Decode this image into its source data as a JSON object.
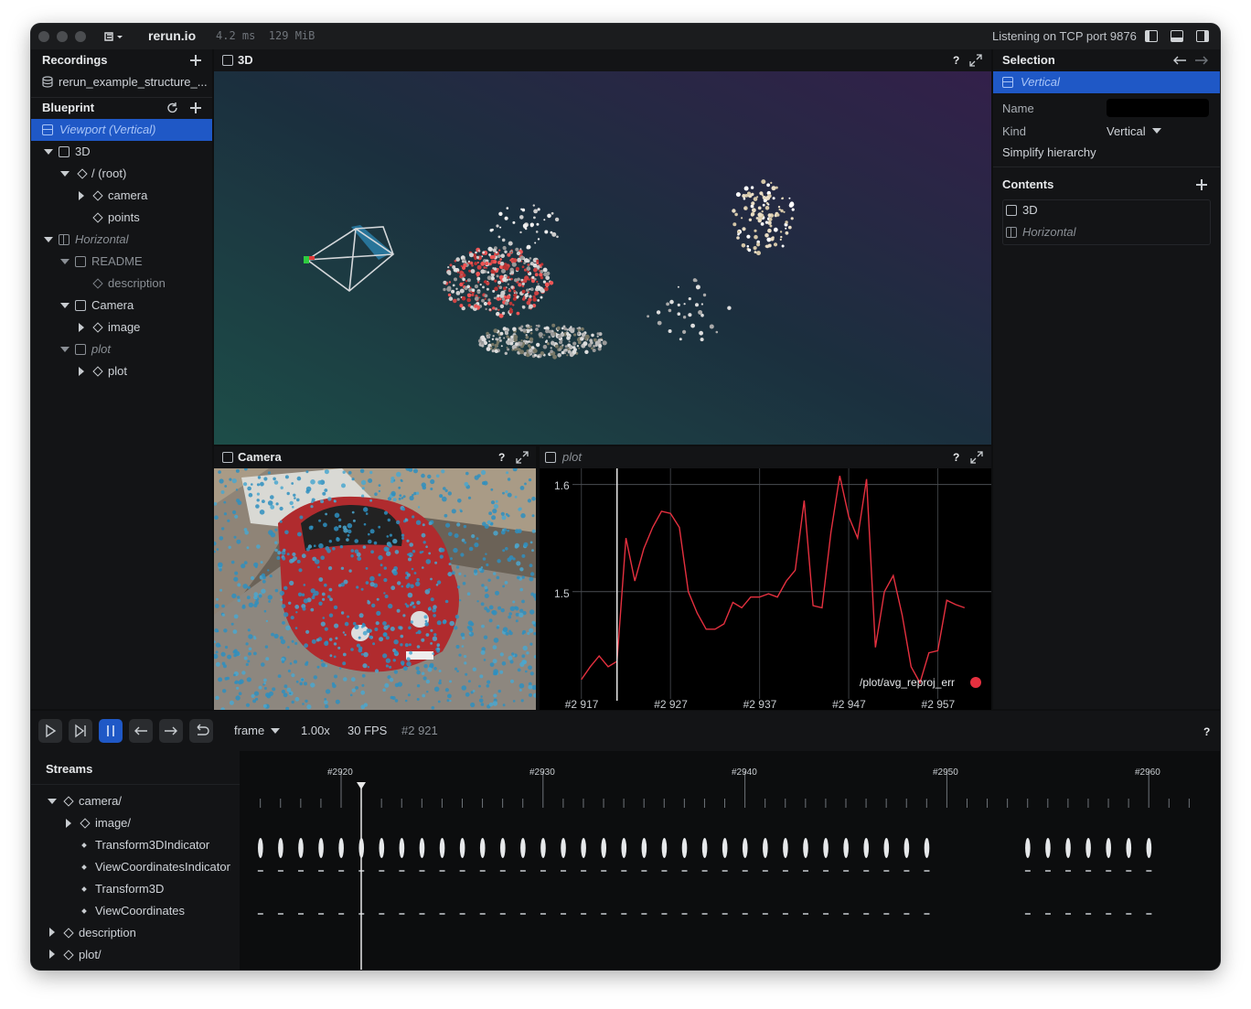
{
  "titlebar": {
    "app_name": "rerun.io",
    "stats": "4.2 ms  129 MiB",
    "status": "Listening on TCP port 9876"
  },
  "left": {
    "recordings_title": "Recordings",
    "recording_item": "rerun_example_structure_...",
    "blueprint_title": "Blueprint",
    "tree": [
      {
        "label": "Viewport (Vertical)",
        "italic": true,
        "selected": true
      },
      {
        "label": "3D"
      },
      {
        "label": "/ (root)"
      },
      {
        "label": "camera"
      },
      {
        "label": "points"
      },
      {
        "label": "Horizontal",
        "italic": true
      },
      {
        "label": "README"
      },
      {
        "label": "description"
      },
      {
        "label": "Camera"
      },
      {
        "label": "image"
      },
      {
        "label": "plot",
        "italic": true
      },
      {
        "label": "plot"
      }
    ]
  },
  "views": {
    "view3d_title": "3D",
    "camera_title": "Camera",
    "plot_title": "plot",
    "help": "?"
  },
  "selection": {
    "title": "Selection",
    "selected_item": "Vertical",
    "name_label": "Name",
    "kind_label": "Kind",
    "kind_value": "Vertical",
    "simplify": "Simplify hierarchy",
    "contents_title": "Contents",
    "contents": [
      "3D",
      "Horizontal"
    ]
  },
  "plot": {
    "legend": "/plot/avg_reproj_err",
    "y_ticks": [
      "1.6",
      "1.5"
    ],
    "x_ticks": [
      "#2 917",
      "#2 927",
      "#2 937",
      "#2 947",
      "#2 957"
    ]
  },
  "chart_data": {
    "type": "line",
    "series": [
      {
        "name": "/plot/avg_reproj_err",
        "color": "#e5303f",
        "x": [
          2917,
          2918,
          2919,
          2920,
          2921,
          2922,
          2923,
          2924,
          2925,
          2926,
          2927,
          2928,
          2929,
          2930,
          2931,
          2932,
          2933,
          2934,
          2935,
          2936,
          2937,
          2938,
          2939,
          2940,
          2941,
          2942,
          2943,
          2944,
          2945,
          2946,
          2947,
          2948,
          2949,
          2950,
          2951,
          2952,
          2953,
          2954,
          2955,
          2956,
          2957,
          2958,
          2959,
          2960
        ],
        "y": [
          1.418,
          1.43,
          1.44,
          1.43,
          1.435,
          1.55,
          1.51,
          1.54,
          1.56,
          1.575,
          1.573,
          1.56,
          1.5,
          1.48,
          1.465,
          1.465,
          1.47,
          1.49,
          1.485,
          1.495,
          1.495,
          1.498,
          1.495,
          1.51,
          1.52,
          1.585,
          1.487,
          1.485,
          1.555,
          1.608,
          1.57,
          1.55,
          1.605,
          1.448,
          1.5,
          1.515,
          1.478,
          1.43,
          1.415,
          1.443,
          1.445,
          1.492,
          1.488,
          1.485
        ]
      }
    ],
    "xlim": [
      2916,
      2963
    ],
    "ylim": [
      1.4,
      1.615
    ]
  },
  "timeline": {
    "timeline_name": "frame",
    "speed": "1.00x",
    "fps": "30 FPS",
    "current": "#2 921",
    "streams_title": "Streams",
    "ruler_labels": [
      "#2920",
      "#2930",
      "#2940",
      "#2950",
      "#2960"
    ],
    "streams": [
      "camera/",
      "image/",
      "Transform3DIndicator",
      "ViewCoordinatesIndicator",
      "Transform3D",
      "ViewCoordinates",
      "description",
      "plot/"
    ]
  },
  "colors": {
    "accent": "#1f58c6",
    "line": "#e5303f",
    "point": "#2e8fbf"
  }
}
